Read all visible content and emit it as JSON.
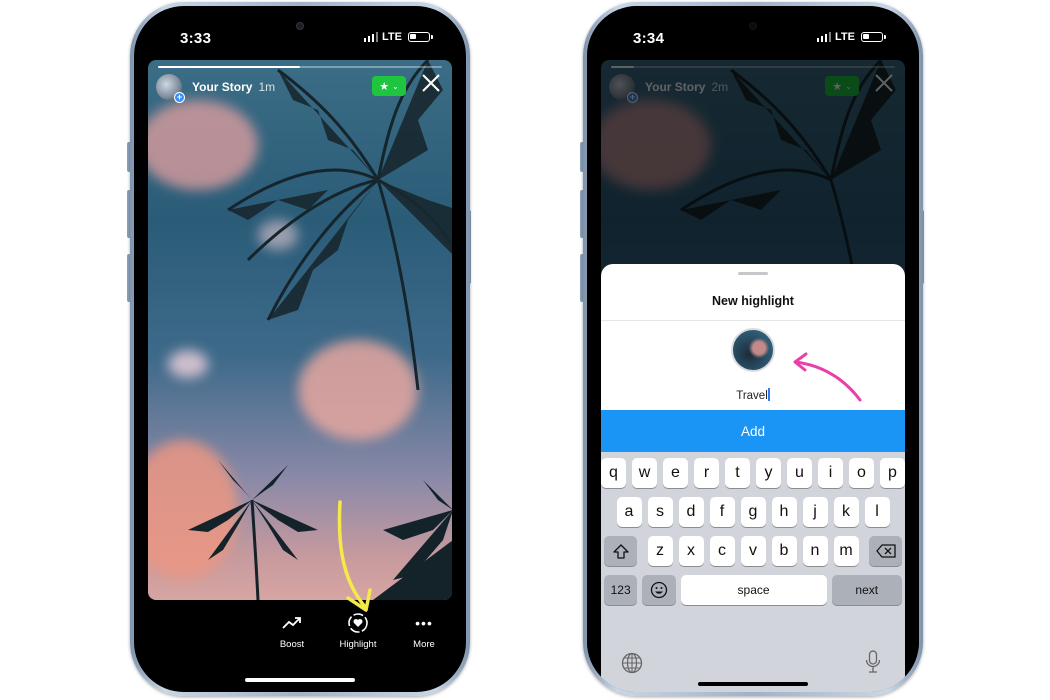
{
  "left_phone": {
    "status": {
      "time": "3:33",
      "network": "LTE"
    },
    "story": {
      "user": "Your Story",
      "age": "1m",
      "progress_fraction": 0.5,
      "favorite_badge_icon": "star-icon",
      "close_icon": "close-icon"
    },
    "actions": [
      {
        "label": "Boost",
        "icon": "trending-up-icon"
      },
      {
        "label": "Highlight",
        "icon": "heart-circle-icon"
      },
      {
        "label": "More",
        "icon": "more-icon"
      }
    ],
    "annotation": {
      "type": "arrow",
      "color": "#f5e94a",
      "target": "Highlight"
    }
  },
  "right_phone": {
    "status": {
      "time": "3:34",
      "network": "LTE"
    },
    "story": {
      "user": "Your Story",
      "age": "2m",
      "progress_fraction": 0.08
    },
    "sheet": {
      "title": "New highlight",
      "name_value": "Travel",
      "add_label": "Add"
    },
    "keyboard": {
      "row1": [
        "q",
        "w",
        "e",
        "r",
        "t",
        "y",
        "u",
        "i",
        "o",
        "p"
      ],
      "row2": [
        "a",
        "s",
        "d",
        "f",
        "g",
        "h",
        "j",
        "k",
        "l"
      ],
      "row3": [
        "z",
        "x",
        "c",
        "v",
        "b",
        "n",
        "m"
      ],
      "numbers_label": "123",
      "space_label": "space",
      "return_label": "next"
    },
    "annotation": {
      "type": "arrow",
      "color": "#ea3ea8",
      "target": "highlight cover"
    }
  },
  "colors": {
    "accent_blue": "#1a95f6",
    "favorite_green": "#1fc43f",
    "yellow_arrow": "#f5e94a",
    "pink_arrow": "#ea3ea8"
  }
}
